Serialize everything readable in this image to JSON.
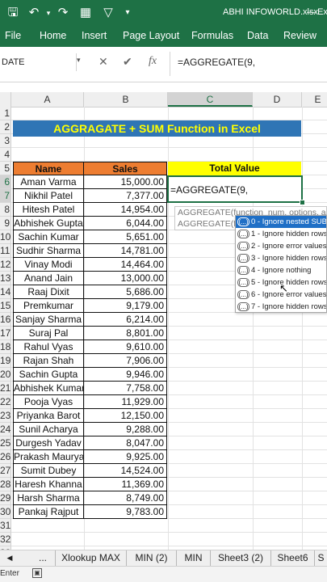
{
  "window": {
    "title": "ABHI INFOWORLD.xlsx",
    "app_suffix": "Exc"
  },
  "ribbon": {
    "tabs": [
      "File",
      "Home",
      "Insert",
      "Page Layout",
      "Formulas",
      "Data",
      "Review"
    ]
  },
  "formula_bar": {
    "name_box": "DATE",
    "formula": "=AGGREGATE(9,"
  },
  "columns": [
    "A",
    "B",
    "C",
    "D",
    "E"
  ],
  "rows": [
    "1",
    "2",
    "3",
    "4",
    "5",
    "6",
    "7",
    "8",
    "9",
    "10",
    "11",
    "12",
    "13",
    "14",
    "15",
    "16",
    "17",
    "18",
    "19",
    "20",
    "21",
    "22",
    "23",
    "24",
    "25",
    "26",
    "27",
    "28",
    "29",
    "30",
    "31",
    "32",
    "33"
  ],
  "sheet": {
    "title": "AGGRAGATE + SUM Function in Excel",
    "header_name": "Name",
    "header_sales": "Sales",
    "header_total": "Total Value",
    "active_cell_text": "=AGGREGATE(9,",
    "data": [
      {
        "name": "Aman Varma",
        "sales": "15,000.00"
      },
      {
        "name": "Nikhil Patel",
        "sales": "7,377.00"
      },
      {
        "name": "Hitesh Patel",
        "sales": "14,954.00"
      },
      {
        "name": "Abhishek Gupta",
        "sales": "6,044.00"
      },
      {
        "name": "Sachin Kumar",
        "sales": "5,651.00"
      },
      {
        "name": "Sudhir Sharma",
        "sales": "14,781.00"
      },
      {
        "name": "Vinay Modi",
        "sales": "14,464.00"
      },
      {
        "name": "Anand Jain",
        "sales": "13,000.00"
      },
      {
        "name": "Raaj Dixit",
        "sales": "5,686.00"
      },
      {
        "name": "Premkumar",
        "sales": "9,179.00"
      },
      {
        "name": "Sanjay Sharma",
        "sales": "6,214.00"
      },
      {
        "name": "Suraj Pal",
        "sales": "8,801.00"
      },
      {
        "name": "Rahul Vyas",
        "sales": "9,610.00"
      },
      {
        "name": "Rajan Shah",
        "sales": "7,906.00"
      },
      {
        "name": "Sachin Gupta",
        "sales": "9,946.00"
      },
      {
        "name": "Abhishek Kumar",
        "sales": "7,758.00"
      },
      {
        "name": "Pooja Vyas",
        "sales": "11,929.00"
      },
      {
        "name": "Priyanka Barot",
        "sales": "12,150.00"
      },
      {
        "name": "Sunil Acharya",
        "sales": "9,288.00"
      },
      {
        "name": "Durgesh Yadav",
        "sales": "8,047.00"
      },
      {
        "name": "Prakash Maurya",
        "sales": "9,925.00"
      },
      {
        "name": "Sumit Dubey",
        "sales": "14,524.00"
      },
      {
        "name": "Haresh Khanna",
        "sales": "11,369.00"
      },
      {
        "name": "Harsh Sharma",
        "sales": "8,749.00"
      },
      {
        "name": "Pankaj Rajput",
        "sales": "9,783.00"
      }
    ]
  },
  "tooltip": {
    "line1": "AGGREGATE(function_num, options, arr",
    "line2": "AGGREGATE(fu"
  },
  "autocomplete": [
    {
      "icon": "(...)",
      "label": "0 - Ignore nested SUBT",
      "selected": true
    },
    {
      "icon": "(...)",
      "label": "1 - Ignore hidden rows"
    },
    {
      "icon": "(...)",
      "label": "2 - Ignore error values,"
    },
    {
      "icon": "(...)",
      "label": "3 - Ignore hidden rows"
    },
    {
      "icon": "(...)",
      "label": "4 - Ignore nothing"
    },
    {
      "icon": "(...)",
      "label": "5 - Ignore hidden rows"
    },
    {
      "icon": "(...)",
      "label": "6 - Ignore error values"
    },
    {
      "icon": "(...)",
      "label": "7 - Ignore hidden rows"
    }
  ],
  "sheet_tabs": [
    "...",
    "Xlookup MAX",
    "MIN (2)",
    "MIN",
    "Sheet3 (2)",
    "Sheet6",
    "S"
  ],
  "status": {
    "mode": "Enter"
  },
  "colors": {
    "excel_green": "#1e7145",
    "title_band": "#2f75b5",
    "title_text": "#ffff00",
    "header_orange": "#ed7d31",
    "total_yellow": "#ffff00",
    "selection_blue": "#1f6fc6"
  }
}
